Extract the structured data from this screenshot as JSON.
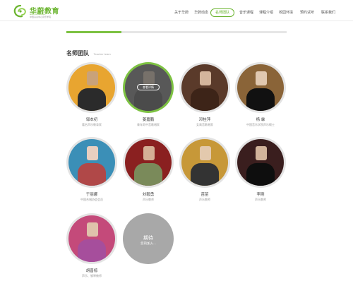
{
  "brand": {
    "name_cn": "华蔚教育",
    "name_en": "HUAYUNUKALU",
    "tagline": "中国演奏中心音乐学院",
    "green": "#6ab42e"
  },
  "nav": {
    "items": [
      {
        "label": "关于华蔚",
        "active": false
      },
      {
        "label": "华蔚动态",
        "active": false
      },
      {
        "label": "名师团队",
        "active": true
      },
      {
        "label": "音乐课程",
        "active": false
      },
      {
        "label": "课程介绍",
        "active": false
      },
      {
        "label": "校园环境",
        "active": false
      },
      {
        "label": "预约试听",
        "active": false
      },
      {
        "label": "联系我们",
        "active": false
      }
    ]
  },
  "progress": {
    "value": 0.25
  },
  "section": {
    "title_cn": "名师团队",
    "title_en": "Teacher team"
  },
  "teachers": [
    {
      "name": "邹本初",
      "role": "著名声乐教育家",
      "bg": "#e8a530",
      "face": "#c9a27a",
      "body": "#2b2b2b"
    },
    {
      "name": "姜嘉鹏",
      "role": "青年男中音歌唱家",
      "bg": "#7a7a7a",
      "face": "#bfb2a3",
      "body": "#5e5e5e",
      "hover": true,
      "hover_label": "查看详情"
    },
    {
      "name": "邓桂萍",
      "role": "女高音歌唱家",
      "bg": "#5a3a2a",
      "face": "#d4b59c",
      "body": "#3d2418"
    },
    {
      "name": "杨 霖",
      "role": "中国音乐学院声乐硕士",
      "bg": "#8a6438",
      "face": "#e0c8b0",
      "body": "#111111"
    },
    {
      "name": "于丽娜",
      "role": "中国合唱协会会员",
      "bg": "#3b8fb7",
      "face": "#e8cfc0",
      "body": "#b04848"
    },
    {
      "name": "刘毅勇",
      "role": "声乐教师",
      "bg": "#8a2020",
      "face": "#d5b096",
      "body": "#7a8a5a"
    },
    {
      "name": "苗苗",
      "role": "声乐教师",
      "bg": "#c79838",
      "face": "#e3c9ad",
      "body": "#333333"
    },
    {
      "name": "李刚",
      "role": "声乐教师",
      "bg": "#3a1e1e",
      "face": "#d1b39a",
      "body": "#0e0e0e"
    },
    {
      "name": "胡晋椋",
      "role": "声乐、钢琴教师",
      "bg": "#c44a7a",
      "face": "#dfc2ab",
      "body": "#a64e9c"
    }
  ],
  "placeholder": {
    "title": "期待",
    "subtitle": "您的加入..."
  }
}
